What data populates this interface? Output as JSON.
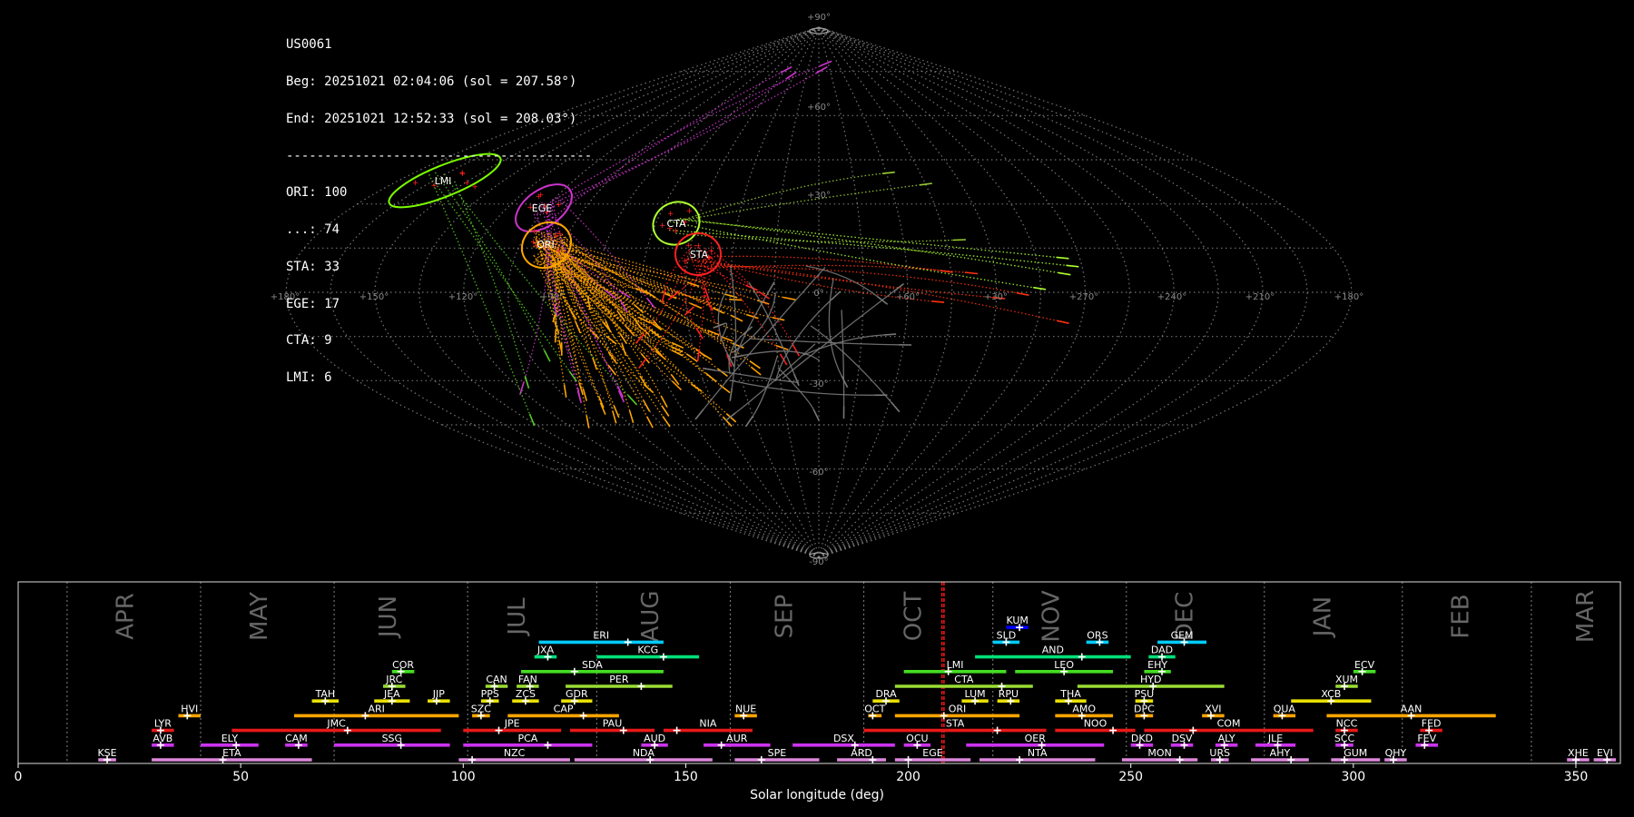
{
  "header": {
    "station": "US0061",
    "begin": "Beg: 20251021 02:04:06 (sol = 207.58°)",
    "end": "End: 20251021 12:52:33 (sol = 208.03°)",
    "separator": "----------------------------------------",
    "counts": [
      "ORI: 100",
      "...: 74",
      "STA: 33",
      "EGE: 17",
      "CTA: 9",
      "LMI: 6"
    ]
  },
  "sky_map": {
    "projection": "sinusoidal",
    "lat_labels": [
      "+90°",
      "+60°",
      "+30°",
      "0°",
      "-30°",
      "-60°",
      "-90°"
    ],
    "lon_labels": [
      "+180°",
      "+150°",
      "+120°",
      "+90°",
      "+60°",
      "+30°",
      "+270°",
      "+240°",
      "+210°",
      "+180°"
    ],
    "radiants": [
      {
        "code": "LMI",
        "color": "#7cfc00"
      },
      {
        "code": "EGE",
        "color": "#cc33cc"
      },
      {
        "code": "ORI",
        "color": "#ffa500"
      },
      {
        "code": "CTA",
        "color": "#adff2f"
      },
      {
        "code": "STA",
        "color": "#ff2020"
      }
    ]
  },
  "chart_data": {
    "type": "timeline",
    "xlabel": "Solar longitude (deg)",
    "xlim": [
      0,
      360
    ],
    "xticks": [
      0,
      50,
      100,
      150,
      200,
      250,
      300,
      350
    ],
    "current_sol": [
      207.58,
      208.03
    ],
    "months": [
      {
        "name": "APR",
        "sol": 24
      },
      {
        "name": "MAY",
        "sol": 54
      },
      {
        "name": "JUN",
        "sol": 83
      },
      {
        "name": "JUL",
        "sol": 112
      },
      {
        "name": "AUG",
        "sol": 142
      },
      {
        "name": "SEP",
        "sol": 172
      },
      {
        "name": "OCT",
        "sol": 201
      },
      {
        "name": "NOV",
        "sol": 232
      },
      {
        "name": "DEC",
        "sol": 262
      },
      {
        "name": "JAN",
        "sol": 293
      },
      {
        "name": "FEB",
        "sol": 324
      },
      {
        "name": "MAR",
        "sol": 352
      }
    ],
    "month_boundaries": [
      11,
      41,
      71,
      101,
      130,
      160,
      190,
      219,
      249,
      280,
      311,
      340
    ],
    "showers": [
      {
        "code": "KUM",
        "start": 222,
        "end": 227,
        "peak": 225,
        "row": 10,
        "color": "#0000ff"
      },
      {
        "code": "ERI",
        "start": 117,
        "end": 145,
        "peak": 137,
        "row": 9,
        "color": "#00ccff"
      },
      {
        "code": "SLD",
        "start": 219,
        "end": 225,
        "peak": 222,
        "row": 9,
        "color": "#00ccff"
      },
      {
        "code": "ORS",
        "start": 240,
        "end": 245,
        "peak": 243,
        "row": 9,
        "color": "#00ccff"
      },
      {
        "code": "GEM",
        "start": 256,
        "end": 267,
        "peak": 262,
        "row": 9,
        "color": "#00ccff"
      },
      {
        "code": "JXA",
        "start": 116,
        "end": 121,
        "peak": 119,
        "row": 8,
        "color": "#00e07a"
      },
      {
        "code": "KCG",
        "start": 130,
        "end": 153,
        "peak": 145,
        "row": 8,
        "color": "#00e07a"
      },
      {
        "code": "AND",
        "start": 215,
        "end": 250,
        "peak": 239,
        "row": 8,
        "color": "#00e07a"
      },
      {
        "code": "DAD",
        "start": 254,
        "end": 260,
        "peak": 257,
        "row": 8,
        "color": "#00e07a"
      },
      {
        "code": "COR",
        "start": 84,
        "end": 89,
        "peak": 86,
        "row": 7,
        "color": "#44dd22"
      },
      {
        "code": "SDA",
        "start": 113,
        "end": 145,
        "peak": 125,
        "row": 7,
        "color": "#44dd22"
      },
      {
        "code": "LMI",
        "start": 199,
        "end": 222,
        "peak": 209,
        "row": 7,
        "color": "#44dd22"
      },
      {
        "code": "LEO",
        "start": 224,
        "end": 246,
        "peak": 235,
        "row": 7,
        "color": "#44dd22"
      },
      {
        "code": "EHY",
        "start": 253,
        "end": 259,
        "peak": 257,
        "row": 7,
        "color": "#44dd22"
      },
      {
        "code": "ECV",
        "start": 300,
        "end": 305,
        "peak": 302,
        "row": 7,
        "color": "#44dd22"
      },
      {
        "code": "JRC",
        "start": 82,
        "end": 87,
        "peak": 84,
        "row": 6,
        "color": "#99dd33"
      },
      {
        "code": "CAN",
        "start": 105,
        "end": 110,
        "peak": 107,
        "row": 6,
        "color": "#99dd33"
      },
      {
        "code": "FAN",
        "start": 112,
        "end": 117,
        "peak": 115,
        "row": 6,
        "color": "#99dd33"
      },
      {
        "code": "PER",
        "start": 123,
        "end": 147,
        "peak": 140,
        "row": 6,
        "color": "#99dd33"
      },
      {
        "code": "CTA",
        "start": 197,
        "end": 228,
        "peak": 221,
        "row": 6,
        "color": "#99dd33"
      },
      {
        "code": "HYD",
        "start": 238,
        "end": 271,
        "peak": 255,
        "row": 6,
        "color": "#99dd33"
      },
      {
        "code": "XUM",
        "start": 296,
        "end": 301,
        "peak": 298,
        "row": 6,
        "color": "#99dd33"
      },
      {
        "code": "TAH",
        "start": 66,
        "end": 72,
        "peak": 69,
        "row": 5,
        "color": "#e8e000"
      },
      {
        "code": "JEA",
        "start": 80,
        "end": 88,
        "peak": 84,
        "row": 5,
        "color": "#e8e000"
      },
      {
        "code": "JIP",
        "start": 92,
        "end": 97,
        "peak": 94,
        "row": 5,
        "color": "#e8e000"
      },
      {
        "code": "PPS",
        "start": 104,
        "end": 108,
        "peak": 106,
        "row": 5,
        "color": "#e8e000"
      },
      {
        "code": "ZCS",
        "start": 111,
        "end": 117,
        "peak": 114,
        "row": 5,
        "color": "#e8e000"
      },
      {
        "code": "GDR",
        "start": 122,
        "end": 129,
        "peak": 125,
        "row": 5,
        "color": "#e8e000"
      },
      {
        "code": "DRA",
        "start": 192,
        "end": 198,
        "peak": 195,
        "row": 5,
        "color": "#e8e000"
      },
      {
        "code": "LUM",
        "start": 212,
        "end": 218,
        "peak": 215,
        "row": 5,
        "color": "#e8e000"
      },
      {
        "code": "RPU",
        "start": 220,
        "end": 225,
        "peak": 223,
        "row": 5,
        "color": "#e8e000"
      },
      {
        "code": "THA",
        "start": 233,
        "end": 240,
        "peak": 236,
        "row": 5,
        "color": "#e8e000"
      },
      {
        "code": "PSU",
        "start": 251,
        "end": 255,
        "peak": 253,
        "row": 5,
        "color": "#e8e000"
      },
      {
        "code": "XCB",
        "start": 286,
        "end": 304,
        "peak": 295,
        "row": 5,
        "color": "#e8e000"
      },
      {
        "code": "HVI",
        "start": 36,
        "end": 41,
        "peak": 38,
        "row": 4,
        "color": "#ffa500"
      },
      {
        "code": "ARI",
        "start": 62,
        "end": 99,
        "peak": 78,
        "row": 4,
        "color": "#ffa500"
      },
      {
        "code": "SZC",
        "start": 102,
        "end": 106,
        "peak": 104,
        "row": 4,
        "color": "#ffa500"
      },
      {
        "code": "CAP",
        "start": 110,
        "end": 135,
        "peak": 127,
        "row": 4,
        "color": "#ffa500"
      },
      {
        "code": "NUE",
        "start": 161,
        "end": 166,
        "peak": 163,
        "row": 4,
        "color": "#ffa500"
      },
      {
        "code": "OCT",
        "start": 191,
        "end": 194,
        "peak": 192,
        "row": 4,
        "color": "#ffa500"
      },
      {
        "code": "ORI",
        "start": 197,
        "end": 225,
        "peak": 208,
        "row": 4,
        "color": "#ffa500"
      },
      {
        "code": "AMO",
        "start": 233,
        "end": 246,
        "peak": 239,
        "row": 4,
        "color": "#ffa500"
      },
      {
        "code": "DPC",
        "start": 251,
        "end": 255,
        "peak": 253,
        "row": 4,
        "color": "#ffa500"
      },
      {
        "code": "XVI",
        "start": 266,
        "end": 271,
        "peak": 268,
        "row": 4,
        "color": "#ffa500"
      },
      {
        "code": "QUA",
        "start": 282,
        "end": 287,
        "peak": 284,
        "row": 4,
        "color": "#ffa500"
      },
      {
        "code": "AAN",
        "start": 294,
        "end": 332,
        "peak": 313,
        "row": 4,
        "color": "#ffa500"
      },
      {
        "code": "LYR",
        "start": 30,
        "end": 35,
        "peak": 32,
        "row": 3,
        "color": "#e81818"
      },
      {
        "code": "JMC",
        "start": 48,
        "end": 95,
        "peak": 74,
        "row": 3,
        "color": "#e81818"
      },
      {
        "code": "JPE",
        "start": 100,
        "end": 122,
        "peak": 108,
        "row": 3,
        "color": "#e81818"
      },
      {
        "code": "PAU",
        "start": 124,
        "end": 143,
        "peak": 136,
        "row": 3,
        "color": "#e81818"
      },
      {
        "code": "NIA",
        "start": 145,
        "end": 165,
        "peak": 148,
        "row": 3,
        "color": "#e81818"
      },
      {
        "code": "STA",
        "start": 190,
        "end": 231,
        "peak": 220,
        "row": 3,
        "color": "#e81818"
      },
      {
        "code": "NOO",
        "start": 233,
        "end": 251,
        "peak": 246,
        "row": 3,
        "color": "#e81818"
      },
      {
        "code": "COM",
        "start": 253,
        "end": 291,
        "peak": 264,
        "row": 3,
        "color": "#e81818"
      },
      {
        "code": "NCC",
        "start": 296,
        "end": 301,
        "peak": 298,
        "row": 3,
        "color": "#e81818"
      },
      {
        "code": "FED",
        "start": 315,
        "end": 320,
        "peak": 317,
        "row": 3,
        "color": "#e81818"
      },
      {
        "code": "AVB",
        "start": 30,
        "end": 35,
        "peak": 32,
        "row": 2,
        "color": "#cc33ee"
      },
      {
        "code": "ELY",
        "start": 41,
        "end": 54,
        "peak": 49,
        "row": 2,
        "color": "#cc33ee"
      },
      {
        "code": "CAM",
        "start": 60,
        "end": 65,
        "peak": 63,
        "row": 2,
        "color": "#cc33ee"
      },
      {
        "code": "SSG",
        "start": 71,
        "end": 97,
        "peak": 86,
        "row": 2,
        "color": "#cc33ee"
      },
      {
        "code": "PCA",
        "start": 100,
        "end": 129,
        "peak": 119,
        "row": 2,
        "color": "#cc33ee"
      },
      {
        "code": "AUD",
        "start": 140,
        "end": 146,
        "peak": 143,
        "row": 2,
        "color": "#cc33ee"
      },
      {
        "code": "AUR",
        "start": 154,
        "end": 169,
        "peak": 158,
        "row": 2,
        "color": "#cc33ee"
      },
      {
        "code": "DSX",
        "start": 174,
        "end": 197,
        "peak": 188,
        "row": 2,
        "color": "#cc33ee"
      },
      {
        "code": "OCU",
        "start": 199,
        "end": 205,
        "peak": 202,
        "row": 2,
        "color": "#cc33ee"
      },
      {
        "code": "OER",
        "start": 213,
        "end": 244,
        "peak": 230,
        "row": 2,
        "color": "#cc33ee"
      },
      {
        "code": "DKD",
        "start": 250,
        "end": 255,
        "peak": 252,
        "row": 2,
        "color": "#cc33ee"
      },
      {
        "code": "DSV",
        "start": 259,
        "end": 264,
        "peak": 262,
        "row": 2,
        "color": "#cc33ee"
      },
      {
        "code": "ALY",
        "start": 269,
        "end": 274,
        "peak": 271,
        "row": 2,
        "color": "#cc33ee"
      },
      {
        "code": "JLE",
        "start": 278,
        "end": 287,
        "peak": 283,
        "row": 2,
        "color": "#cc33ee"
      },
      {
        "code": "SCC",
        "start": 296,
        "end": 300,
        "peak": 298,
        "row": 2,
        "color": "#cc33ee"
      },
      {
        "code": "FEV",
        "start": 314,
        "end": 319,
        "peak": 316,
        "row": 2,
        "color": "#cc33ee"
      },
      {
        "code": "KSE",
        "start": 18,
        "end": 22,
        "peak": 20,
        "row": 1,
        "color": "#dd88dd"
      },
      {
        "code": "ETA",
        "start": 30,
        "end": 66,
        "peak": 46,
        "row": 1,
        "color": "#dd88dd"
      },
      {
        "code": "NZC",
        "start": 99,
        "end": 124,
        "peak": 102,
        "row": 1,
        "color": "#dd88dd"
      },
      {
        "code": "NDA",
        "start": 125,
        "end": 156,
        "peak": 142,
        "row": 1,
        "color": "#dd88dd"
      },
      {
        "code": "SPE",
        "start": 161,
        "end": 180,
        "peak": 167,
        "row": 1,
        "color": "#dd88dd"
      },
      {
        "code": "ARD",
        "start": 184,
        "end": 195,
        "peak": 192,
        "row": 1,
        "color": "#dd88dd"
      },
      {
        "code": "EGE",
        "start": 197,
        "end": 214,
        "peak": 200,
        "row": 1,
        "color": "#dd88dd"
      },
      {
        "code": "NTA",
        "start": 216,
        "end": 242,
        "peak": 225,
        "row": 1,
        "color": "#dd88dd"
      },
      {
        "code": "MON",
        "start": 248,
        "end": 265,
        "peak": 261,
        "row": 1,
        "color": "#dd88dd"
      },
      {
        "code": "URS",
        "start": 268,
        "end": 272,
        "peak": 270,
        "row": 1,
        "color": "#dd88dd"
      },
      {
        "code": "AHY",
        "start": 277,
        "end": 290,
        "peak": 286,
        "row": 1,
        "color": "#dd88dd"
      },
      {
        "code": "GUM",
        "start": 295,
        "end": 306,
        "peak": 298,
        "row": 1,
        "color": "#dd88dd"
      },
      {
        "code": "QHY",
        "start": 307,
        "end": 312,
        "peak": 309,
        "row": 1,
        "color": "#dd88dd"
      },
      {
        "code": "XHE",
        "start": 348,
        "end": 353,
        "peak": 350,
        "row": 1,
        "color": "#dd88dd"
      },
      {
        "code": "EVI",
        "start": 354,
        "end": 359,
        "peak": 357,
        "row": 1,
        "color": "#dd88dd"
      }
    ]
  }
}
